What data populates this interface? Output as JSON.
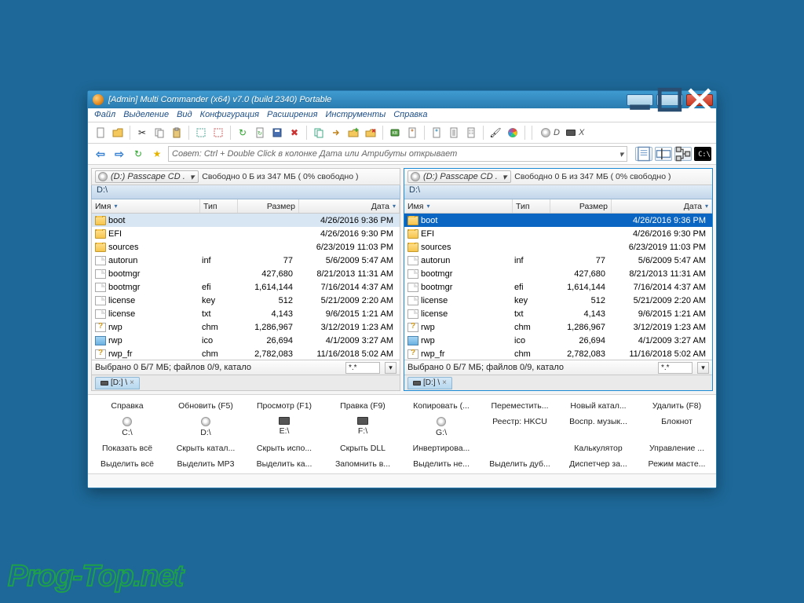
{
  "title": "[Admin] Multi Commander (x64)  v7.0 (build 2340) Portable",
  "menu": [
    "Файл",
    "Выделение",
    "Вид",
    "Конфигурация",
    "Расширения",
    "Инструменты",
    "Справка"
  ],
  "toolbar1": {
    "icons": [
      "file-icon",
      "open-icon",
      "cut-icon",
      "copy-icon",
      "paste-icon",
      "select-rect-icon",
      "deselect-rect-icon",
      "refresh-green-icon",
      "refresh-doc-icon",
      "save-icon",
      "delete-icon",
      "copy-path-icon",
      "move-icon",
      "folder-new-icon",
      "delete-folder-icon",
      "kb-chip-icon",
      "page-a-icon",
      "page-b-icon",
      "doc-list-icon",
      "doc-grid-icon",
      "brush-icon",
      "color-wheel-icon"
    ],
    "drive_letter_d": "D",
    "drive_letter_x": "X"
  },
  "toolbar2": {
    "nav_icons": [
      "back-icon",
      "forward-icon",
      "reload-icon",
      "favorite-icon"
    ],
    "tips_text": "Совет: Ctrl + Double Click в колонке Дата или Атрибуты открывает",
    "cluster_icons": [
      "notepad-icon",
      "rename-icon",
      "tree-icon",
      "console-icon"
    ]
  },
  "panes_common": {
    "drive_label": "(D:) Passcape CD .",
    "free_text": "Свободно 0 Б из 347 МБ ( 0% свободно )",
    "path": "D:\\",
    "columns": {
      "name": "Имя",
      "type": "Тип",
      "size": "Размер",
      "date": "Дата"
    },
    "status_text": "Выбрано 0 Б/7 МБ; файлов 0/9, катало",
    "filter_value": "*.*",
    "tab_label": "[D:] \\"
  },
  "files": [
    {
      "icon": "folder",
      "name": "boot",
      "type": "",
      "size": "",
      "date": "4/26/2016 9:36 PM",
      "sel": true
    },
    {
      "icon": "folder",
      "name": "EFI",
      "type": "",
      "size": "",
      "date": "4/26/2016 9:30 PM"
    },
    {
      "icon": "folder",
      "name": "sources",
      "type": "",
      "size": "",
      "date": "6/23/2019 11:03 PM"
    },
    {
      "icon": "file",
      "name": "autorun",
      "type": "inf",
      "size": "77",
      "date": "5/6/2009 5:47 AM"
    },
    {
      "icon": "file",
      "name": "bootmgr",
      "type": "",
      "size": "427,680",
      "date": "8/21/2013 11:31 AM"
    },
    {
      "icon": "file",
      "name": "bootmgr",
      "type": "efi",
      "size": "1,614,144",
      "date": "7/16/2014 4:37 AM"
    },
    {
      "icon": "file",
      "name": "license",
      "type": "key",
      "size": "512",
      "date": "5/21/2009 2:20 AM"
    },
    {
      "icon": "file",
      "name": "license",
      "type": "txt",
      "size": "4,143",
      "date": "9/6/2015 1:21 AM"
    },
    {
      "icon": "help",
      "name": "rwp",
      "type": "chm",
      "size": "1,286,967",
      "date": "3/12/2019 1:23 AM"
    },
    {
      "icon": "icon",
      "name": "rwp",
      "type": "ico",
      "size": "26,694",
      "date": "4/1/2009 3:27 AM"
    },
    {
      "icon": "help",
      "name": "rwp_fr",
      "type": "chm",
      "size": "2,782,083",
      "date": "11/16/2018 5:02 AM"
    }
  ],
  "cmd_rows": [
    [
      "Справка",
      "Обновить (F5)",
      "Просмотр (F1)",
      "Правка (F9)",
      "Копировать (...",
      "Переместить...",
      "Новый катал...",
      "Удалить (F8)"
    ],
    [
      {
        "drive": "disc",
        "label": "C:\\"
      },
      {
        "drive": "disc",
        "label": "D:\\"
      },
      {
        "drive": "slot",
        "label": "E:\\"
      },
      {
        "drive": "slot",
        "label": "F:\\"
      },
      {
        "drive": "disc",
        "label": "G:\\"
      },
      "Реестр: HKCU",
      "Воспр. музык...",
      "Блокнот"
    ],
    [
      "Показать всё",
      "Скрыть катал...",
      "Скрыть испо...",
      "Скрыть DLL",
      "Инвертирова...",
      "",
      "Калькулятор",
      "Управление ..."
    ],
    [
      "Выделить всё",
      "Выделить MP3",
      "Выделить ка...",
      "Запомнить в...",
      "Выделить не...",
      "Выделить дуб...",
      "Диспетчер за...",
      "Режим масте..."
    ]
  ],
  "watermark": "Prog-Top.net"
}
